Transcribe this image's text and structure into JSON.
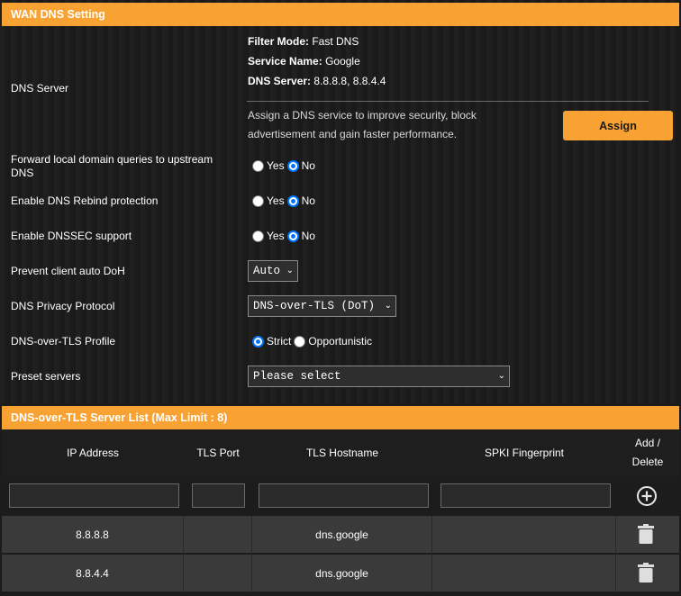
{
  "dns_section": {
    "title": "WAN DNS Setting",
    "dns_server": {
      "label": "DNS Server",
      "filter_mode_key": "Filter Mode:",
      "filter_mode_val": "Fast DNS",
      "service_name_key": "Service Name:",
      "service_name_val": "Google",
      "dns_server_key": "DNS Server:",
      "dns_server_val": "8.8.8.8, 8.8.4.4",
      "description": "Assign a DNS service to improve security, block advertisement and gain faster performance.",
      "assign_label": "Assign"
    },
    "forward_local": {
      "label": "Forward local domain queries to upstream DNS",
      "yes": "Yes",
      "no": "No",
      "selected": "No"
    },
    "rebind": {
      "label": "Enable DNS Rebind protection",
      "yes": "Yes",
      "no": "No",
      "selected": "No"
    },
    "dnssec": {
      "label": "Enable DNSSEC support",
      "yes": "Yes",
      "no": "No",
      "selected": "No"
    },
    "auto_doh": {
      "label": "Prevent client auto DoH",
      "value": "Auto"
    },
    "privacy_protocol": {
      "label": "DNS Privacy Protocol",
      "value": "DNS-over-TLS (DoT)"
    },
    "tls_profile": {
      "label": "DNS-over-TLS Profile",
      "strict": "Strict",
      "opportunistic": "Opportunistic",
      "selected": "Strict"
    },
    "preset": {
      "label": "Preset servers",
      "value": "Please select"
    }
  },
  "server_list": {
    "title": "DNS-over-TLS Server List (Max Limit : 8)",
    "columns": {
      "ip": "IP Address",
      "port": "TLS Port",
      "hostname": "TLS Hostname",
      "spki": "SPKI Fingerprint",
      "action_1": "Add /",
      "action_2": "Delete"
    },
    "rows": [
      {
        "ip": "8.8.8.8",
        "port": "",
        "hostname": "dns.google",
        "spki": ""
      },
      {
        "ip": "8.8.4.4",
        "port": "",
        "hostname": "dns.google",
        "spki": ""
      }
    ]
  },
  "colors": {
    "accent": "#f7a233",
    "radio_checked": "#0075ff",
    "background": "#1c1c1c",
    "row": "#3a3a3a"
  },
  "icons": {
    "add": "plus-circle-icon",
    "delete": "trash-icon",
    "dropdown": "chevron-down-icon"
  }
}
